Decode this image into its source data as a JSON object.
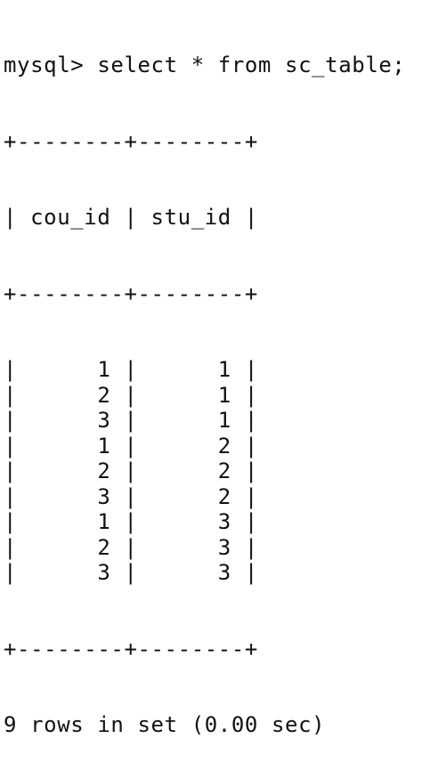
{
  "terminal": {
    "command": "mysql> select * from sc_table;",
    "border": "+--------+--------+",
    "columns": [
      "cou_id",
      "stu_id"
    ],
    "rows": [
      [
        "1",
        "1"
      ],
      [
        "2",
        "1"
      ],
      [
        "3",
        "1"
      ],
      [
        "1",
        "2"
      ],
      [
        "2",
        "2"
      ],
      [
        "3",
        "2"
      ],
      [
        "1",
        "3"
      ],
      [
        "2",
        "3"
      ],
      [
        "3",
        "3"
      ]
    ],
    "summary": "9 rows in set (0.00 sec)"
  }
}
